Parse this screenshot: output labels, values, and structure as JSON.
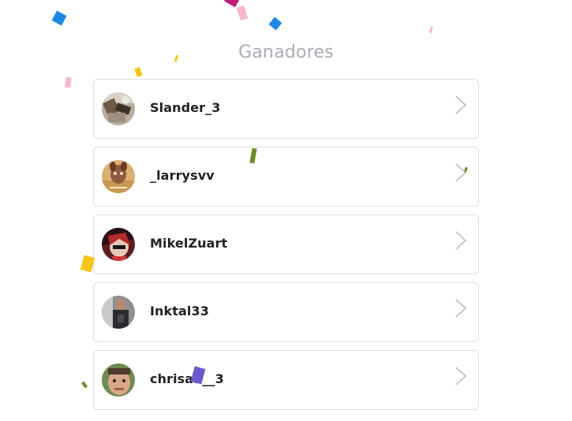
{
  "header": {
    "title": "Ganadores"
  },
  "winners": [
    {
      "username": "Slander_3",
      "avatar": "avatar-icon"
    },
    {
      "username": "_larrysvv",
      "avatar": "avatar-icon"
    },
    {
      "username": "MikelZuart",
      "avatar": "avatar-icon"
    },
    {
      "username": "Inktal33",
      "avatar": "avatar-icon"
    },
    {
      "username": "chrisa1__3",
      "avatar": "avatar-icon"
    }
  ],
  "icons": {
    "row_action": "chevron-right-icon"
  },
  "colors": {
    "title": "#a9acb4",
    "row_border": "#dcdee2",
    "chevron": "#b9bcc2",
    "confetti": [
      "#1e88e5",
      "#f5c518",
      "#f6b8c8",
      "#6b8e23",
      "#6a5acd",
      "#c2187a"
    ]
  }
}
